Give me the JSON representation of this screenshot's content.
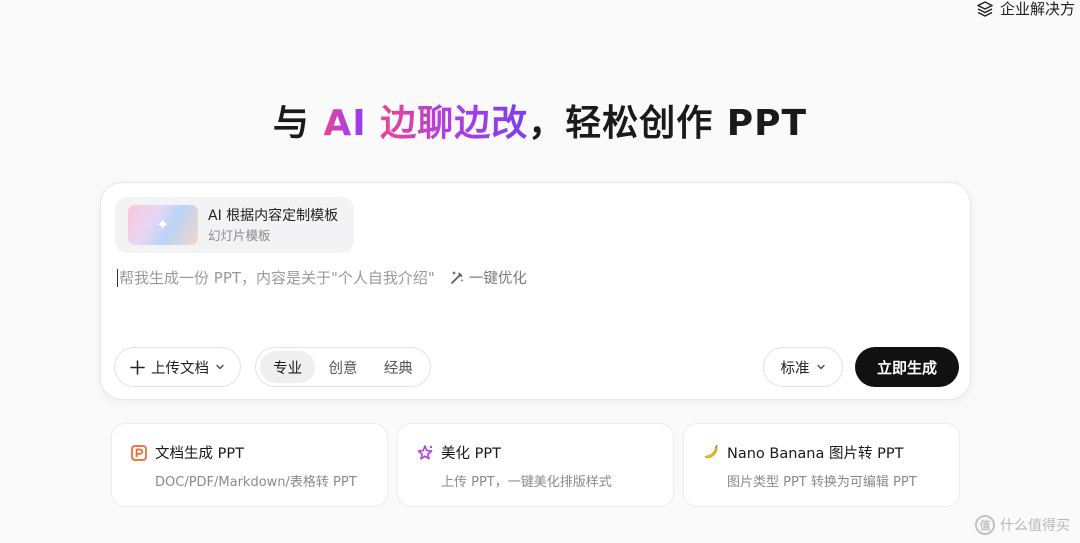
{
  "header": {
    "enterprise_label": "企业解决方",
    "enterprise_icon": "layers-icon"
  },
  "headline": {
    "prefix": "与 ",
    "highlight_ai": "AI ",
    "highlight_rest": "边聊边改",
    "suffix": "，轻松创作 PPT"
  },
  "composer": {
    "template": {
      "title": "AI 根据内容定制模板",
      "subtitle": "幻灯片模板"
    },
    "prompt_placeholder": "帮我生成一份 PPT，内容是关于\"个人自我介绍\"",
    "optimize_label": "一键优化",
    "upload_label": "上传文档",
    "styles": [
      {
        "label": "专业",
        "active": true
      },
      {
        "label": "创意",
        "active": false
      },
      {
        "label": "经典",
        "active": false
      }
    ],
    "level_label": "标准",
    "generate_label": "立即生成"
  },
  "features": [
    {
      "title": "文档生成 PPT",
      "desc": "DOC/PDF/Markdown/表格转 PPT",
      "icon": "document-ppt-icon",
      "color": "#f0662e"
    },
    {
      "title": "美化 PPT",
      "desc": "上传 PPT，一键美化排版样式",
      "icon": "beautify-star-icon",
      "color": "#b23ee0"
    },
    {
      "title": "Nano Banana 图片转 PPT",
      "desc": "图片类型 PPT 转换为可编辑 PPT",
      "icon": "banana-icon",
      "color": "#f2c12e"
    }
  ],
  "watermark": {
    "text": "什么值得买",
    "seal": "值"
  },
  "colors": {
    "accent_pink": "#e8468f",
    "accent_purple": "#7a3ff0",
    "primary_button": "#111111"
  }
}
